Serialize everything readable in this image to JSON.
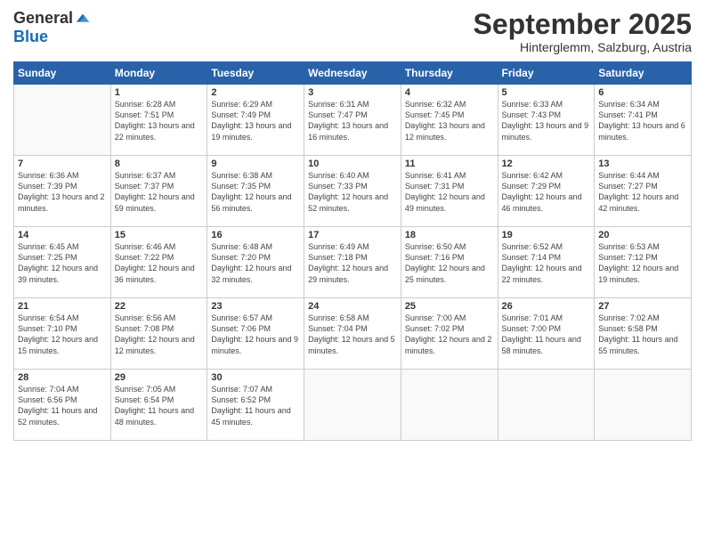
{
  "logo": {
    "general": "General",
    "blue": "Blue"
  },
  "title": "September 2025",
  "subtitle": "Hinterglemm, Salzburg, Austria",
  "days_of_week": [
    "Sunday",
    "Monday",
    "Tuesday",
    "Wednesday",
    "Thursday",
    "Friday",
    "Saturday"
  ],
  "weeks": [
    [
      {
        "day": "",
        "info": ""
      },
      {
        "day": "1",
        "info": "Sunrise: 6:28 AM\nSunset: 7:51 PM\nDaylight: 13 hours\nand 22 minutes."
      },
      {
        "day": "2",
        "info": "Sunrise: 6:29 AM\nSunset: 7:49 PM\nDaylight: 13 hours\nand 19 minutes."
      },
      {
        "day": "3",
        "info": "Sunrise: 6:31 AM\nSunset: 7:47 PM\nDaylight: 13 hours\nand 16 minutes."
      },
      {
        "day": "4",
        "info": "Sunrise: 6:32 AM\nSunset: 7:45 PM\nDaylight: 13 hours\nand 12 minutes."
      },
      {
        "day": "5",
        "info": "Sunrise: 6:33 AM\nSunset: 7:43 PM\nDaylight: 13 hours\nand 9 minutes."
      },
      {
        "day": "6",
        "info": "Sunrise: 6:34 AM\nSunset: 7:41 PM\nDaylight: 13 hours\nand 6 minutes."
      }
    ],
    [
      {
        "day": "7",
        "info": "Sunrise: 6:36 AM\nSunset: 7:39 PM\nDaylight: 13 hours\nand 2 minutes."
      },
      {
        "day": "8",
        "info": "Sunrise: 6:37 AM\nSunset: 7:37 PM\nDaylight: 12 hours\nand 59 minutes."
      },
      {
        "day": "9",
        "info": "Sunrise: 6:38 AM\nSunset: 7:35 PM\nDaylight: 12 hours\nand 56 minutes."
      },
      {
        "day": "10",
        "info": "Sunrise: 6:40 AM\nSunset: 7:33 PM\nDaylight: 12 hours\nand 52 minutes."
      },
      {
        "day": "11",
        "info": "Sunrise: 6:41 AM\nSunset: 7:31 PM\nDaylight: 12 hours\nand 49 minutes."
      },
      {
        "day": "12",
        "info": "Sunrise: 6:42 AM\nSunset: 7:29 PM\nDaylight: 12 hours\nand 46 minutes."
      },
      {
        "day": "13",
        "info": "Sunrise: 6:44 AM\nSunset: 7:27 PM\nDaylight: 12 hours\nand 42 minutes."
      }
    ],
    [
      {
        "day": "14",
        "info": "Sunrise: 6:45 AM\nSunset: 7:25 PM\nDaylight: 12 hours\nand 39 minutes."
      },
      {
        "day": "15",
        "info": "Sunrise: 6:46 AM\nSunset: 7:22 PM\nDaylight: 12 hours\nand 36 minutes."
      },
      {
        "day": "16",
        "info": "Sunrise: 6:48 AM\nSunset: 7:20 PM\nDaylight: 12 hours\nand 32 minutes."
      },
      {
        "day": "17",
        "info": "Sunrise: 6:49 AM\nSunset: 7:18 PM\nDaylight: 12 hours\nand 29 minutes."
      },
      {
        "day": "18",
        "info": "Sunrise: 6:50 AM\nSunset: 7:16 PM\nDaylight: 12 hours\nand 25 minutes."
      },
      {
        "day": "19",
        "info": "Sunrise: 6:52 AM\nSunset: 7:14 PM\nDaylight: 12 hours\nand 22 minutes."
      },
      {
        "day": "20",
        "info": "Sunrise: 6:53 AM\nSunset: 7:12 PM\nDaylight: 12 hours\nand 19 minutes."
      }
    ],
    [
      {
        "day": "21",
        "info": "Sunrise: 6:54 AM\nSunset: 7:10 PM\nDaylight: 12 hours\nand 15 minutes."
      },
      {
        "day": "22",
        "info": "Sunrise: 6:56 AM\nSunset: 7:08 PM\nDaylight: 12 hours\nand 12 minutes."
      },
      {
        "day": "23",
        "info": "Sunrise: 6:57 AM\nSunset: 7:06 PM\nDaylight: 12 hours\nand 9 minutes."
      },
      {
        "day": "24",
        "info": "Sunrise: 6:58 AM\nSunset: 7:04 PM\nDaylight: 12 hours\nand 5 minutes."
      },
      {
        "day": "25",
        "info": "Sunrise: 7:00 AM\nSunset: 7:02 PM\nDaylight: 12 hours\nand 2 minutes."
      },
      {
        "day": "26",
        "info": "Sunrise: 7:01 AM\nSunset: 7:00 PM\nDaylight: 11 hours\nand 58 minutes."
      },
      {
        "day": "27",
        "info": "Sunrise: 7:02 AM\nSunset: 6:58 PM\nDaylight: 11 hours\nand 55 minutes."
      }
    ],
    [
      {
        "day": "28",
        "info": "Sunrise: 7:04 AM\nSunset: 6:56 PM\nDaylight: 11 hours\nand 52 minutes."
      },
      {
        "day": "29",
        "info": "Sunrise: 7:05 AM\nSunset: 6:54 PM\nDaylight: 11 hours\nand 48 minutes."
      },
      {
        "day": "30",
        "info": "Sunrise: 7:07 AM\nSunset: 6:52 PM\nDaylight: 11 hours\nand 45 minutes."
      },
      {
        "day": "",
        "info": ""
      },
      {
        "day": "",
        "info": ""
      },
      {
        "day": "",
        "info": ""
      },
      {
        "day": "",
        "info": ""
      }
    ]
  ]
}
